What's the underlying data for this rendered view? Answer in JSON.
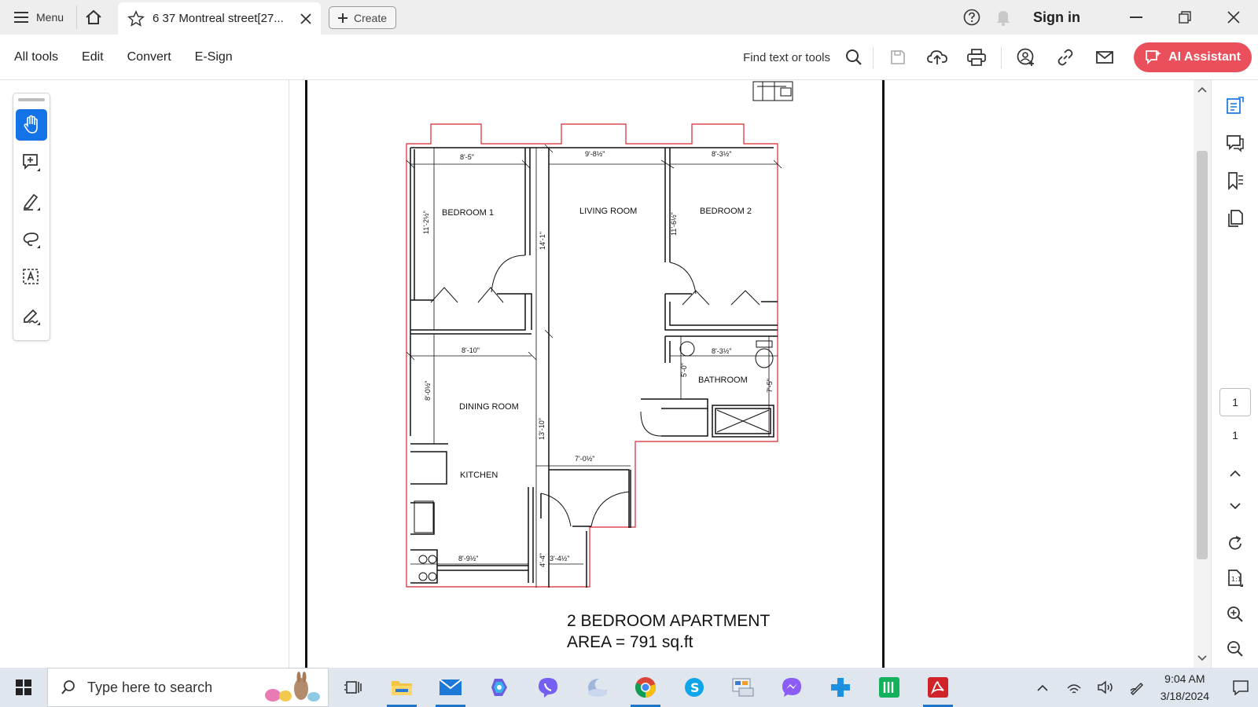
{
  "titlebar": {
    "menu_label": "Menu",
    "tab_title": "6 37 Montreal street[27...",
    "create_label": "Create",
    "sign_in": "Sign in"
  },
  "toolbar": {
    "menu_items": [
      "All tools",
      "Edit",
      "Convert",
      "E-Sign"
    ],
    "find_label": "Find text or tools",
    "ai_label": "AI Assistant",
    "accent": "#e9505b"
  },
  "left_tools": [
    "hand-tool",
    "add-comment",
    "highlight",
    "draw",
    "text-select",
    "sign"
  ],
  "document": {
    "title_line1": "2 BEDROOM APARTMENT",
    "title_line2": "AREA = 791 sq.ft",
    "rooms": {
      "bedroom1": "BEDROOM 1",
      "living": "LIVING ROOM",
      "bedroom2": "BEDROOM 2",
      "bathroom": "BATHROOM",
      "dining": "DINING ROOM",
      "kitchen": "KITCHEN"
    },
    "dims": {
      "d1": "8'-5\"",
      "d2": "9'-8½\"",
      "d3": "8'-3½\"",
      "d4": "11'-2½\"",
      "d5": "14'-1\"",
      "d6": "11'-6½\"",
      "d7": "8'-10\"",
      "d8": "8'-3½\"",
      "d9": "5'-0\"",
      "d10": "7'-5\"",
      "d11": "8'-0½\"",
      "d12": "13'-10\"",
      "d13": "7'-0½\"",
      "d14": "8'-9½\"",
      "d15": "4'-4\"",
      "d16": "3'-4½\""
    }
  },
  "pager": {
    "current": "1",
    "total": "1"
  },
  "taskbar": {
    "search_placeholder": "Type here to search",
    "time": "9:04 AM",
    "date": "3/18/2024"
  }
}
